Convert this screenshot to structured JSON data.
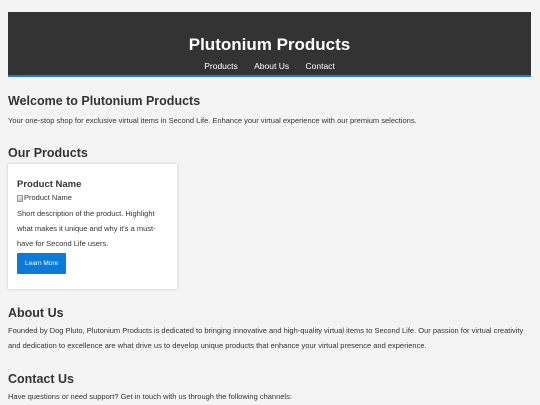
{
  "header": {
    "title": "Plutonium Products",
    "nav": [
      "Products",
      "About Us",
      "Contact"
    ]
  },
  "welcome": {
    "title": "Welcome to Plutonium Products",
    "text": "Your one-stop shop for exclusive virtual items in Second Life. Enhance your virtual experience with our premium selections."
  },
  "products": {
    "title": "Our Products",
    "items": [
      {
        "name": "Product Name",
        "image_alt": "Product Name",
        "description": "Short description of the product. Highlight what makes it unique and why it's a must-have for Second Life users.",
        "button": "Learn More"
      }
    ]
  },
  "about": {
    "title": "About Us",
    "text": "Founded by Dog Pluto, Plutonium Products is dedicated to bringing innovative and high-quality virtual items to Second Life. Our passion for virtual creativity and dedication to excellence are what drive us to develop unique products that enhance your virtual presence and experience."
  },
  "contact": {
    "title": "Contact Us",
    "text": "Have questions or need support? Get in touch with us through the following channels:"
  },
  "colors": {
    "header_bg": "#333333",
    "accent": "#1e7fd8",
    "button": "#0a7bd8",
    "page_bg": "#f4f4f4"
  }
}
